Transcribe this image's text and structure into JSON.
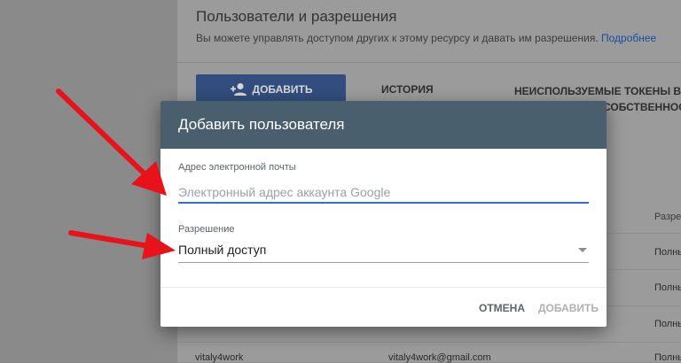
{
  "page": {
    "title": "Пользователи и разрешения",
    "subtitle": "Вы можете управлять доступом других к этому ресурсу и давать им разрешения.",
    "subtitle_link": "Подробнее",
    "add_button_label": "ДОБАВИТЬ",
    "tabs": [
      "ИСТОРИЯ",
      "НЕИСПОЛЬЗУЕМЫЕ ТОКЕНЫ В",
      "СОБСТВЕННОСТИ"
    ],
    "column_header": "Разре",
    "rows": [
      "Полны",
      "Полны",
      "Полны",
      "Полны"
    ],
    "bottom_row": {
      "name": "vitaly4work",
      "email": "vitaly4work@gmail.com",
      "permission": "Полны"
    }
  },
  "modal": {
    "title": "Добавить пользователя",
    "email_label": "Адрес электронной почты",
    "email_placeholder": "Электронный адрес аккаунта Google",
    "email_value": "",
    "permission_label": "Разрешение",
    "permission_value": "Полный доступ",
    "cancel_label": "ОТМЕНА",
    "add_label": "ДОБАВИТЬ"
  },
  "colors": {
    "header_bg": "#4a5f6d",
    "focus_underline": "#2f6fd3",
    "arrow": "#e8121b"
  },
  "icons": {
    "add_user": "person-add-icon",
    "dropdown": "chevron-down-icon"
  }
}
